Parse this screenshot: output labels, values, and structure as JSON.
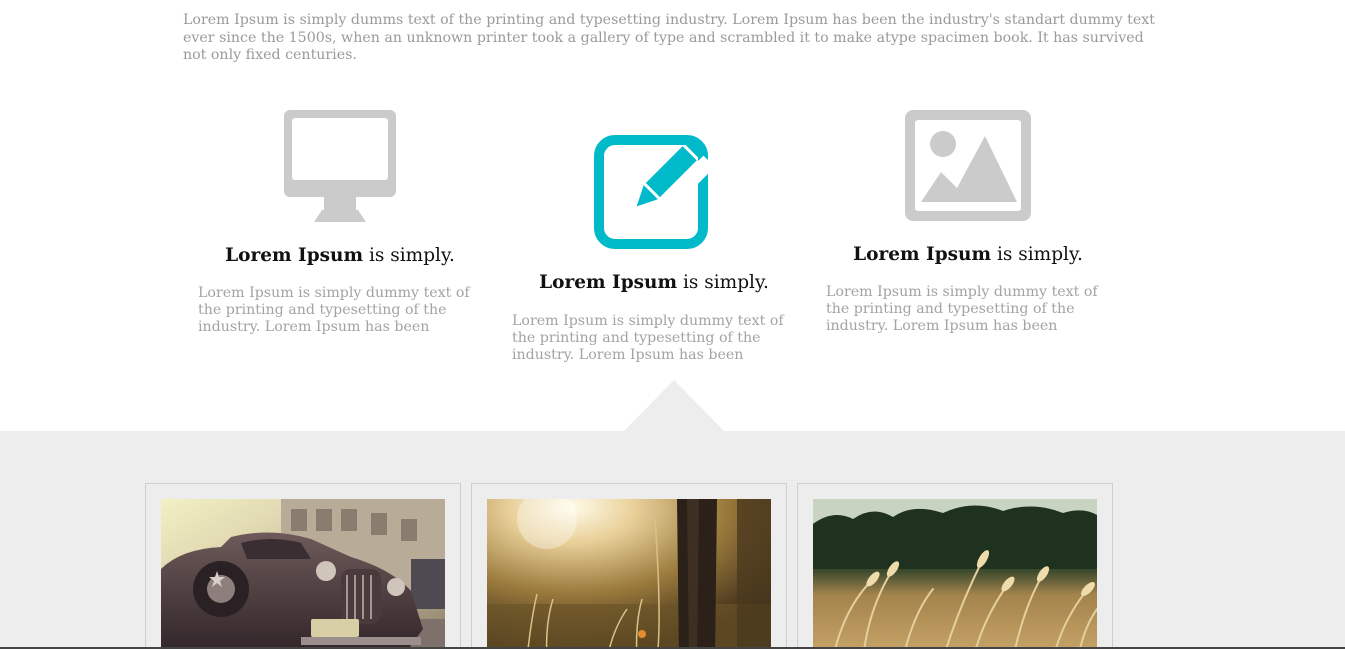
{
  "intro": {
    "text": "Lorem Ipsum is simply dumms text of the printing and typesetting industry. Lorem Ipsum has been the industry's standart dummy text ever since the 1500s, when an unknown printer took a gallery of type and scrambled it to make atype spacimen book. It has survived not only fixed centuries."
  },
  "features": [
    {
      "icon": "monitor-icon",
      "title_bold": "Lorem Ipsum",
      "title_rest": " is simply.",
      "description": "Lorem Ipsum is simply dummy text of the printing and typesetting of the industry. Lorem Ipsum has been",
      "icon_color": "#cbcbcb"
    },
    {
      "icon": "edit-icon",
      "title_bold": "Lorem Ipsum",
      "title_rest": " is simply.",
      "description": "Lorem Ipsum is simply dummy text of the printing and typesetting of the industry. Lorem Ipsum has been",
      "icon_color": "#00b9c9"
    },
    {
      "icon": "image-icon",
      "title_bold": "Lorem Ipsum",
      "title_rest": " is simply.",
      "description": "Lorem Ipsum is simply dummy text of the printing and typesetting of the industry. Lorem Ipsum has been",
      "icon_color": "#cbcbcb"
    }
  ],
  "gallery": {
    "background": "#ededed",
    "photos": [
      "vintage-car-photo",
      "sunlit-meadow-photo",
      "wheat-field-photo"
    ]
  },
  "colors": {
    "accent": "#00b9c9",
    "muted_text": "#9a9a9a"
  }
}
